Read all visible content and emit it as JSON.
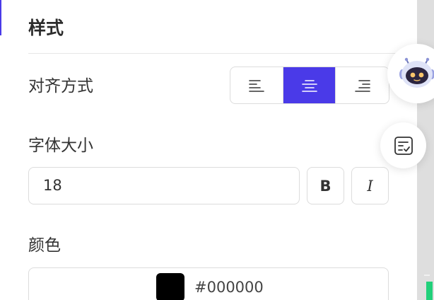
{
  "panel": {
    "title": "样式"
  },
  "alignment": {
    "label": "对齐方式",
    "options": [
      {
        "icon": "align-left-icon",
        "active": false
      },
      {
        "icon": "align-center-icon",
        "active": true
      },
      {
        "icon": "align-right-icon",
        "active": false
      }
    ]
  },
  "font_size": {
    "label": "字体大小",
    "value": "18",
    "bold_label": "B",
    "italic_label": "I"
  },
  "color": {
    "label": "颜色",
    "value": "#000000",
    "swatch": "#000000"
  },
  "floating": {
    "assistant_icon": "robot-icon",
    "notes_icon": "checklist-icon"
  },
  "theme": {
    "accent": "#4a3ae8"
  }
}
